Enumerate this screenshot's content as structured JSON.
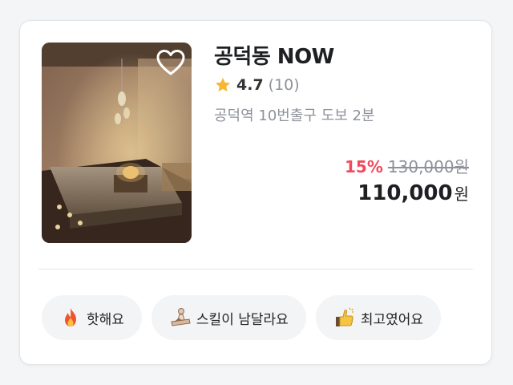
{
  "venue": {
    "name": "공덕동 NOW",
    "rating": "4.7",
    "review_count": "(10)",
    "location": "공덕역 10번출구 도보 2분"
  },
  "price": {
    "discount": "15%",
    "original": "130,000원",
    "final_amount": "110,000",
    "final_unit": "원"
  },
  "tags": [
    {
      "icon": "fire-icon",
      "label": "핫해요"
    },
    {
      "icon": "massage-icon",
      "label": "스킬이 남달라요"
    },
    {
      "icon": "thumbs-up-icon",
      "label": "최고였어요"
    }
  ],
  "colors": {
    "discount": "#f04a5b",
    "star": "#f7b731",
    "muted_text": "#8d9199",
    "tag_background": "#f3f4f6"
  },
  "favorite": {
    "icon": "heart-outline-icon",
    "active": false
  }
}
